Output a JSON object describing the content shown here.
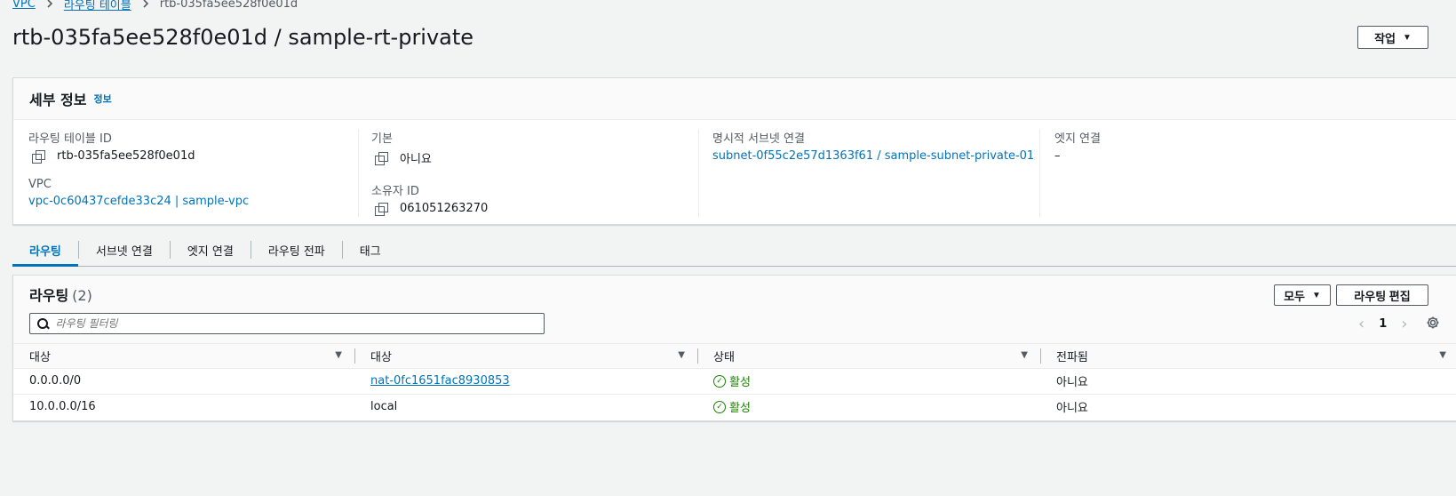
{
  "breadcrumb": {
    "items": [
      "VPC",
      "라우팅 테이블"
    ],
    "current": "rtb-035fa5ee528f0e01d"
  },
  "page": {
    "title": "rtb-035fa5ee528f0e01d / sample-rt-private",
    "actions_label": "작업"
  },
  "details": {
    "title": "세부 정보",
    "info_link": "정보",
    "fields": {
      "route_table_id_label": "라우팅 테이블 ID",
      "route_table_id": "rtb-035fa5ee528f0e01d",
      "vpc_label": "VPC",
      "vpc": "vpc-0c60437cefde33c24 | sample-vpc",
      "main_label": "기본",
      "main": "아니요",
      "owner_label": "소유자 ID",
      "owner": "061051263270",
      "subnet_assoc_label": "명시적 서브넷 연결",
      "subnet_assoc": "subnet-0f55c2e57d1363f61 / sample-subnet-private-01",
      "edge_assoc_label": "엣지 연결",
      "edge_assoc": "–"
    }
  },
  "tabs": [
    "라우팅",
    "서브넷 연결",
    "엣지 연결",
    "라우팅 전파",
    "태그"
  ],
  "routes": {
    "title": "라우팅",
    "count": "(2)",
    "filter_label": "모두",
    "edit_label": "라우팅 편집",
    "search_placeholder": "라우팅 필터링",
    "page": "1",
    "columns": [
      "대상",
      "대상",
      "상태",
      "전파됨"
    ],
    "rows": [
      {
        "destination": "0.0.0.0/0",
        "target": "nat-0fc1651fac8930853",
        "status": "활성",
        "propagated": "아니요"
      },
      {
        "destination": "10.0.0.0/16",
        "target": "local",
        "status": "활성",
        "propagated": "아니요"
      }
    ]
  },
  "colors": {
    "link": "#0073bb",
    "active_status": "#1d8102"
  }
}
